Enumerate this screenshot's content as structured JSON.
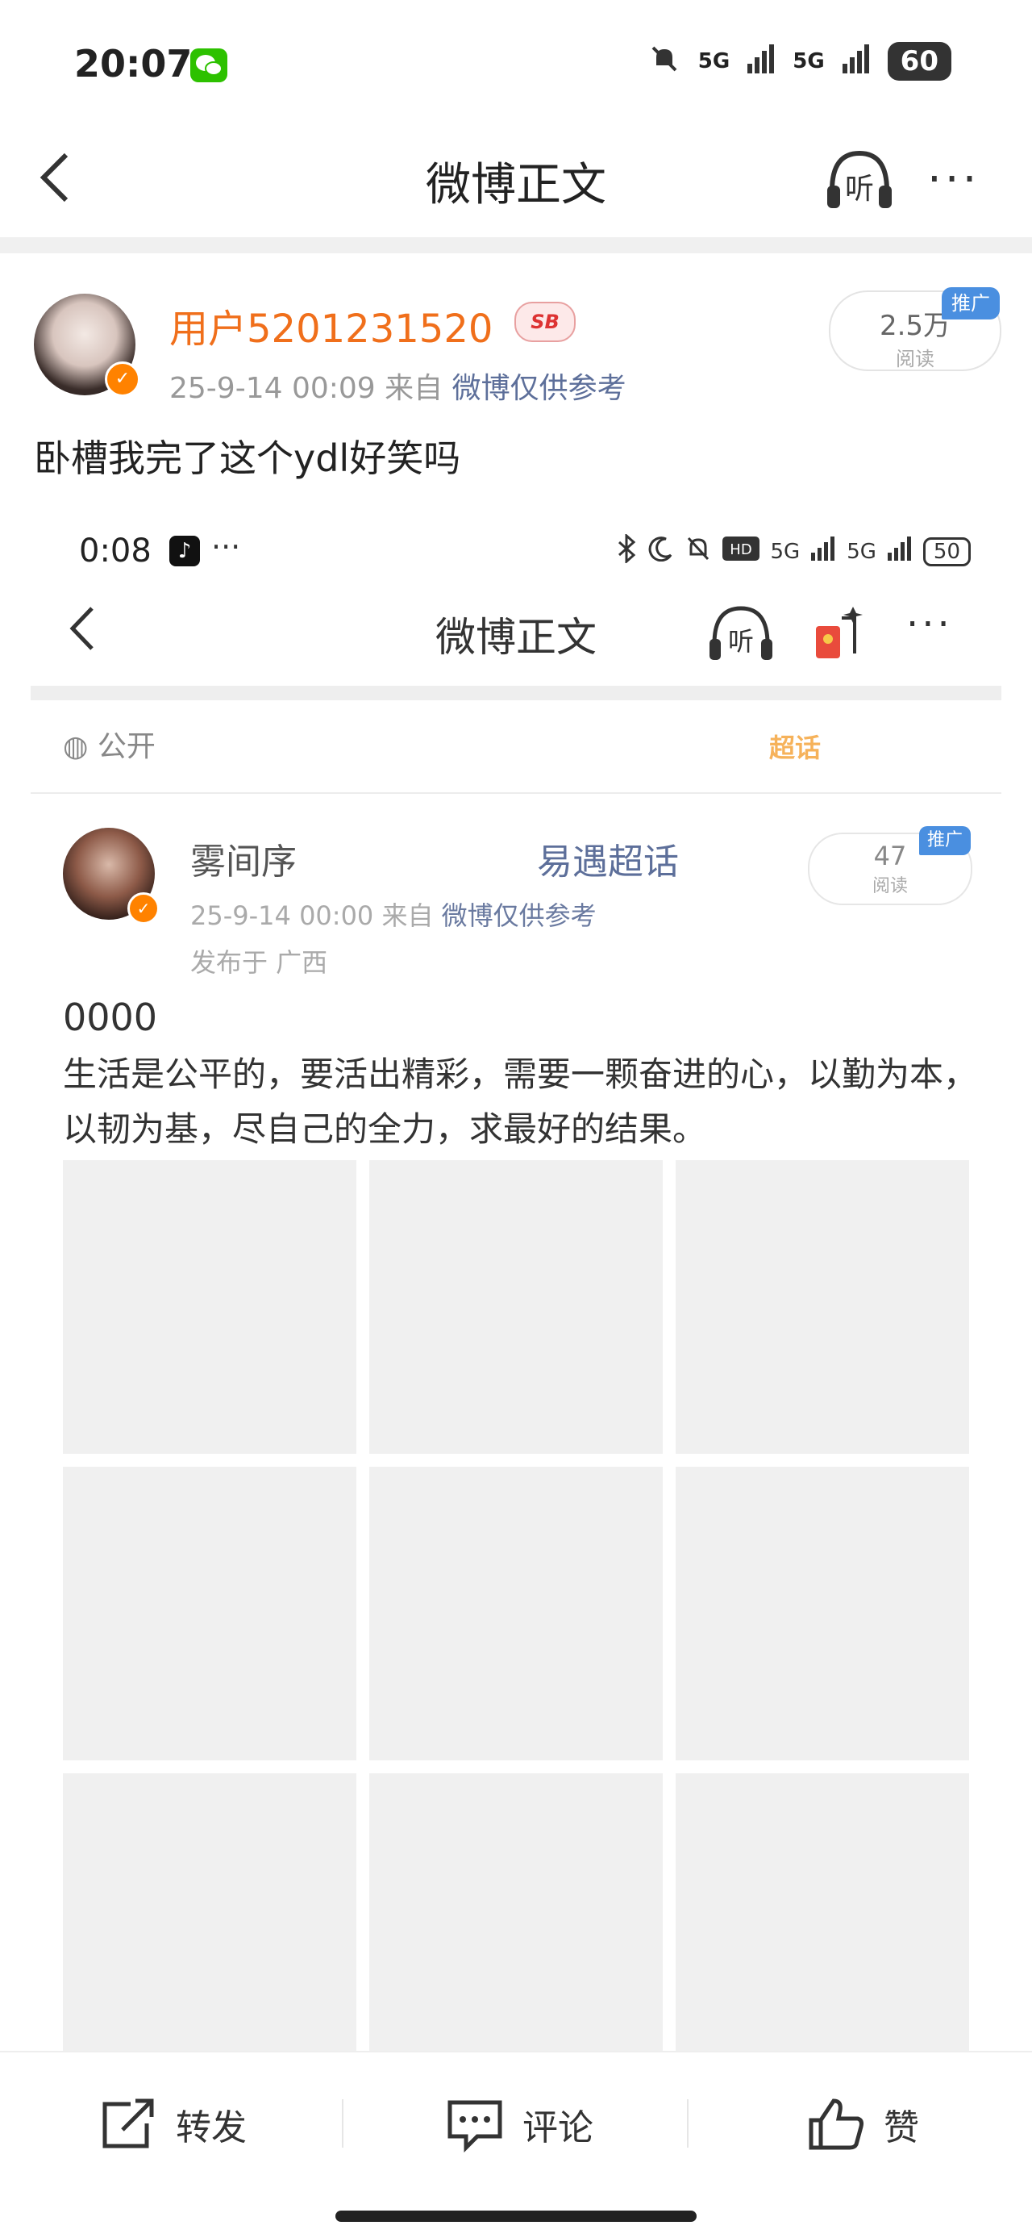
{
  "status_bar": {
    "time": "20:07",
    "signal1": "5G",
    "signal2": "5G",
    "battery": "60"
  },
  "header": {
    "title": "微博正文"
  },
  "post": {
    "username": "用户5201231520",
    "badge": "SB",
    "time": "25-9-14 00:09",
    "from_label": "来自",
    "source": "微博仅供参考",
    "read_count": "2.5万",
    "read_label": "阅读",
    "promo": "推广",
    "text": "卧槽我完了这个ydl好笑吗"
  },
  "embedded": {
    "status": {
      "time": "0:08",
      "tiktok": "♪",
      "dots": "···",
      "signal1": "5G",
      "signal2": "5G",
      "battery": "50"
    },
    "title": "微博正文",
    "visibility": "公开",
    "super_topic_badge": "超话",
    "username": "雾间序",
    "super_topic": "易遇超话",
    "time": "25-9-14 00:00",
    "from_label": "来自",
    "source": "微博仅供参考",
    "location": "发布于 广西",
    "read_count": "47",
    "read_label": "阅读",
    "promo": "推广",
    "title_line": "0000",
    "body": "生活是公平的，要活出精彩，需要一颗奋进的心，以勤为本，以韧为基，尽自己的全力，求最好的结果。"
  },
  "bottom_bar": {
    "repost": "转发",
    "comment": "评论",
    "like": "赞"
  },
  "colors": {
    "username": "#f06f1b",
    "verified": "#ff8200",
    "link": "#5d6f9a",
    "promo": "#4a8fe0"
  }
}
